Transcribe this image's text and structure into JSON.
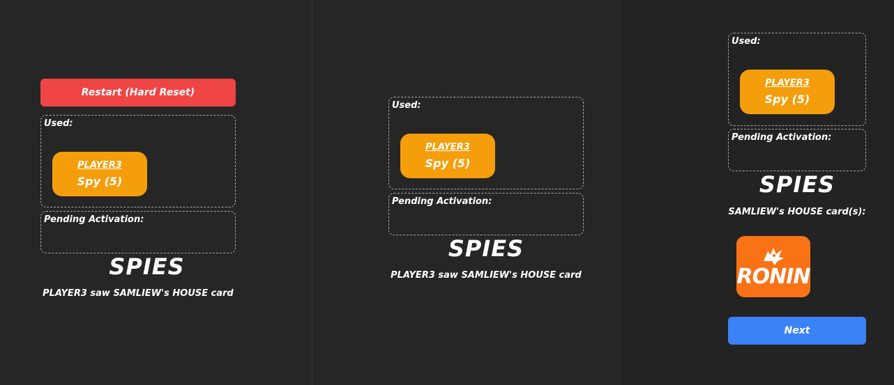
{
  "panel1": {
    "restart_label": "Restart (Hard Reset)",
    "used_label": "Used:",
    "card": {
      "player": "PLAYER3",
      "name": "Spy (5)"
    },
    "pending_label": "Pending Activation:",
    "heading": "SPIES",
    "message": "PLAYER3 saw SAMLIEW's HOUSE card"
  },
  "panel2": {
    "used_label": "Used:",
    "card": {
      "player": "PLAYER3",
      "name": "Spy (5)"
    },
    "pending_label": "Pending Activation:",
    "heading": "SPIES",
    "message": "PLAYER3 saw SAMLIEW's HOUSE card"
  },
  "panel3": {
    "used_label": "Used:",
    "card": {
      "player": "PLAYER3",
      "name": "Spy (5)"
    },
    "pending_label": "Pending Activation:",
    "heading": "SPIES",
    "message": "SAMLIEW's HOUSE card(s):",
    "house_card": {
      "name": "RONIN",
      "icon": "wolf-icon"
    },
    "next_label": "Next"
  },
  "colors": {
    "background": "#262626",
    "restart": "#ef4545",
    "next": "#3b82f6",
    "card": "#f59e0b",
    "house_card": "#f97316"
  }
}
